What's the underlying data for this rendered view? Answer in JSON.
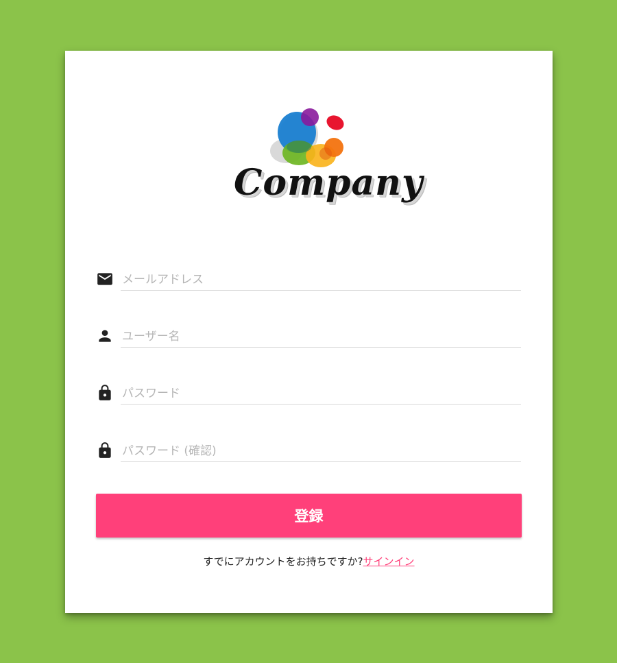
{
  "brand": {
    "logo_text": "Company",
    "icon": "colorful-blobs-logo"
  },
  "form": {
    "fields": [
      {
        "name": "email",
        "placeholder": "メールアドレス",
        "value": "",
        "icon": "mail-icon"
      },
      {
        "name": "username",
        "placeholder": "ユーザー名",
        "value": "",
        "icon": "person-icon"
      },
      {
        "name": "password",
        "placeholder": "パスワード",
        "value": "",
        "icon": "lock-icon"
      },
      {
        "name": "password_confirm",
        "placeholder": "パスワード (確認)",
        "value": "",
        "icon": "lock-icon"
      }
    ],
    "submit_label": "登録"
  },
  "footer": {
    "prompt": "すでにアカウントをお持ちですか?",
    "signin_link": "サインイン"
  },
  "colors": {
    "background": "#8bc34a",
    "card": "#ffffff",
    "accent": "#ff407a"
  }
}
